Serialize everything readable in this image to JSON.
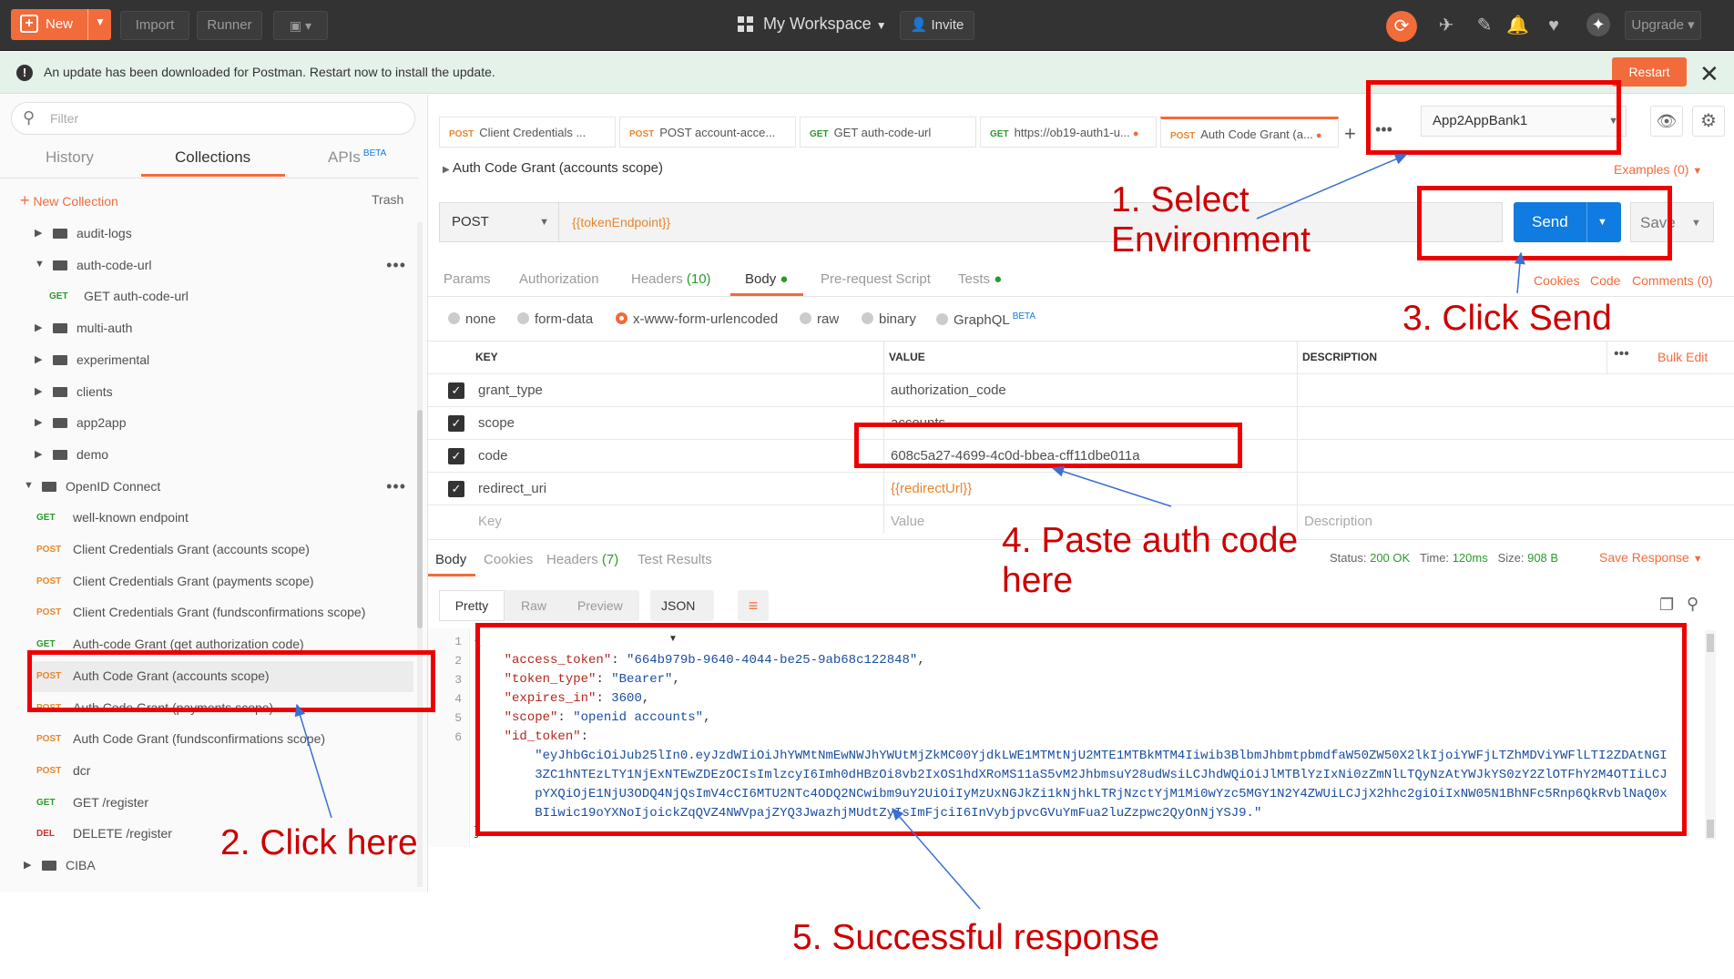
{
  "topbar": {
    "new_label": "New",
    "import_label": "Import",
    "runner_label": "Runner",
    "workspace": "My Workspace",
    "invite_label": "Invite",
    "upgrade_label": "Upgrade"
  },
  "update_bar": {
    "message": "An update has been downloaded for Postman. Restart now to install the update.",
    "restart_label": "Restart"
  },
  "sidebar": {
    "filter_placeholder": "Filter",
    "tabs": [
      "History",
      "Collections",
      "APIs"
    ],
    "apis_badge": "BETA",
    "new_collection": "New Collection",
    "trash": "Trash",
    "items": [
      {
        "type": "folder",
        "label": "audit-logs"
      },
      {
        "type": "folder",
        "label": "auth-code-url"
      },
      {
        "type": "request",
        "method": "GET",
        "label": "GET auth-code-url"
      },
      {
        "type": "folder",
        "label": "multi-auth"
      },
      {
        "type": "folder",
        "label": "experimental"
      },
      {
        "type": "folder",
        "label": "clients"
      },
      {
        "type": "folder",
        "label": "app2app"
      },
      {
        "type": "folder",
        "label": "demo"
      },
      {
        "type": "folder",
        "label": "OpenID Connect"
      },
      {
        "type": "request",
        "method": "GET",
        "label": "well-known endpoint"
      },
      {
        "type": "request",
        "method": "POST",
        "label": "Client Credentials Grant (accounts scope)"
      },
      {
        "type": "request",
        "method": "POST",
        "label": "Client Credentials Grant (payments scope)"
      },
      {
        "type": "request",
        "method": "POST",
        "label": "Client Credentials Grant (fundsconfirmations scope)"
      },
      {
        "type": "request",
        "method": "GET",
        "label": "Auth-code Grant (get authorization code)"
      },
      {
        "type": "request",
        "method": "POST",
        "label": "Auth Code Grant (accounts scope)"
      },
      {
        "type": "request",
        "method": "POST",
        "label": "Auth Code Grant (payments scope)"
      },
      {
        "type": "request",
        "method": "POST",
        "label": "Auth Code Grant (fundsconfirmations scope)"
      },
      {
        "type": "request",
        "method": "POST",
        "label": "dcr"
      },
      {
        "type": "request",
        "method": "GET",
        "label": "GET /register"
      },
      {
        "type": "request",
        "method": "DEL",
        "label": "DELETE /register"
      },
      {
        "type": "folder",
        "label": "CIBA"
      }
    ]
  },
  "request_tabs": [
    {
      "method": "POST",
      "label": "Client Credentials ..."
    },
    {
      "method": "POST",
      "label": "POST account-acce..."
    },
    {
      "method": "GET",
      "label": "GET auth-code-url"
    },
    {
      "method": "GET",
      "label": "https://ob19-auth1-u..."
    },
    {
      "method": "POST",
      "label": "Auth Code Grant (a..."
    }
  ],
  "environment": "App2AppBank1",
  "request": {
    "title": "Auth Code Grant (accounts scope)",
    "examples": "Examples (0)",
    "method": "POST",
    "url": "{{tokenEndpoint}}",
    "send_label": "Send",
    "save_label": "Save"
  },
  "subtabs": {
    "params": "Params",
    "authorization": "Authorization",
    "headers": "Headers",
    "headers_count": "(10)",
    "body": "Body",
    "prerequest": "Pre-request Script",
    "tests": "Tests",
    "cookies": "Cookies",
    "code": "Code",
    "comments": "Comments (0)"
  },
  "body_types": [
    "none",
    "form-data",
    "x-www-form-urlencoded",
    "raw",
    "binary",
    "GraphQL"
  ],
  "graphql_badge": "BETA",
  "kv_table": {
    "headers": [
      "KEY",
      "VALUE",
      "DESCRIPTION"
    ],
    "bulk_edit": "Bulk Edit",
    "rows": [
      {
        "key": "grant_type",
        "value": "authorization_code"
      },
      {
        "key": "scope",
        "value": "accounts"
      },
      {
        "key": "code",
        "value": "608c5a27-4699-4c0d-bbea-cff11dbe011a"
      },
      {
        "key": "redirect_uri",
        "value": "{{redirectUrl}}"
      }
    ],
    "placeholder": {
      "key": "Key",
      "value": "Value",
      "description": "Description"
    }
  },
  "response": {
    "tabs": [
      "Body",
      "Cookies",
      "Headers",
      "Test Results"
    ],
    "headers_count": "(7)",
    "status_label": "Status:",
    "status": "200 OK",
    "time_label": "Time:",
    "time": "120ms",
    "size_label": "Size:",
    "size": "908 B",
    "save_response": "Save Response",
    "views": [
      "Pretty",
      "Raw",
      "Preview"
    ],
    "format": "JSON",
    "json": {
      "access_token": "664b979b-9640-4044-be25-9ab68c122848",
      "token_type": "Bearer",
      "expires_in": "3600",
      "scope": "openid accounts",
      "id_token_lines": [
        "\"eyJhbGciOiJub25lIn0.eyJzdWIiOiJhYWMtNmEwNWJhYWUtMjZkMC00YjdkLWE1MTMtNjU2MTE1MTBkMTM4Iiwib3BlbmJhbmtpbmdfaW50ZW50X2lkIjoiYWFjLTZhMDViYWFlLTI2ZDAtNGI",
        "3ZC1hNTEzLTY1NjExNTEwZDEzOCIsImlzcyI6Imh0dHBzOi8vb2IxOS1hdXRoMS11aS5vM2JhbmsuY28udWsiLCJhdWQiOiJlMTBlYzIxNi0zZmNlLTQyNzAtYWJkYS0zY2ZlOTFhY2M4OTIiLCJ",
        "pYXQiOjE1NjU3ODQ4NjQsImV4cCI6MTU2NTc4ODQ2NCwibm9uY2UiOiIyMzUxNGJkZi1kNjhkLTRjNzctYjM1Mi0wYzc5MGY1N2Y4ZWUiLCJjX2hhc2giOiIxNW05N1BhNFc5Rnp6QkRvblNaQ0x",
        "BIiwic19oYXNoIjoickZqQVZ4NWVpajZYQ3JwazhjMUdtZyIsImFjciI6InVybjpvcGVuYmFua2luZzpwc2QyOnNjYSJ9.\""
      ]
    }
  },
  "annotations": {
    "step1": "1. Select Environment",
    "step2": "2. Click here",
    "step3": "3. Click Send",
    "step4": "4. Paste auth code here",
    "step5": "5. Successful response"
  },
  "colors": {
    "accent": "#f26b3a",
    "send": "#107be0",
    "annotation": "#dd0000"
  }
}
